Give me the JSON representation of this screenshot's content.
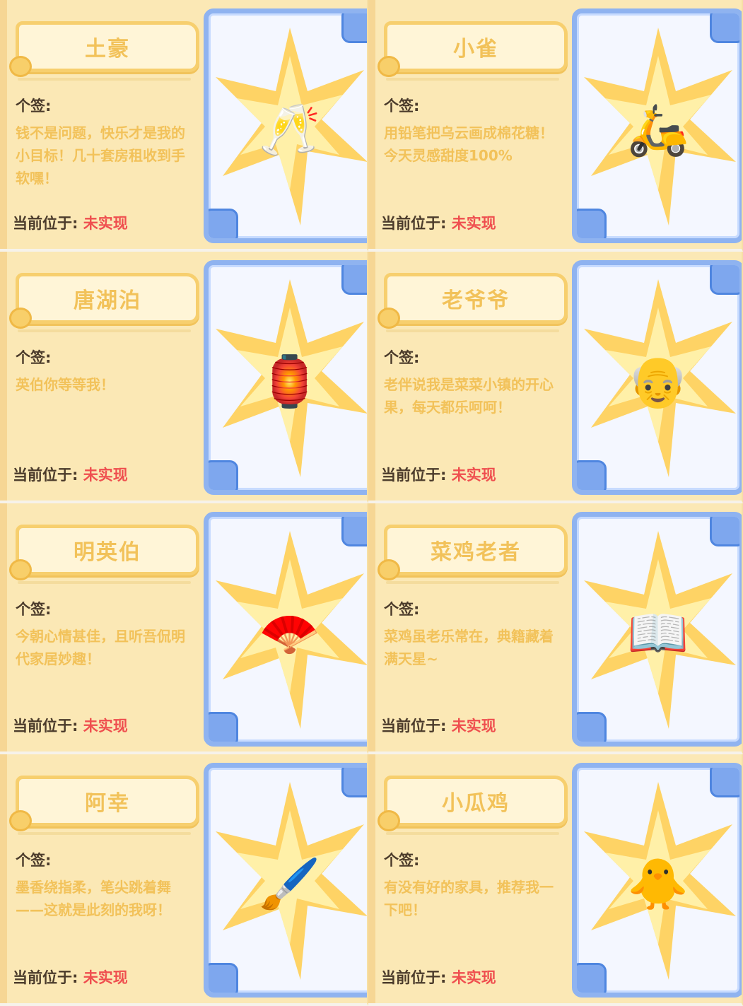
{
  "cards": [
    {
      "name": "土豪",
      "signature_label": "个签:",
      "signature": "钱不是问题，快乐才是我的小目标！几十套房租收到手软嘿！",
      "location_label": "当前位于:",
      "location_value": "未实现",
      "glyph": "🥂"
    },
    {
      "name": "小雀",
      "signature_label": "个签:",
      "signature": "用铅笔把乌云画成棉花糖！今天灵感甜度100%",
      "location_label": "当前位于:",
      "location_value": "未实现",
      "glyph": "🛵"
    },
    {
      "name": "唐湖泊",
      "signature_label": "个签:",
      "signature": "英伯你等等我！",
      "location_label": "当前位于:",
      "location_value": "未实现",
      "glyph": "🏮"
    },
    {
      "name": "老爷爷",
      "signature_label": "个签:",
      "signature": "老伴说我是菜菜小镇的开心果，每天都乐呵呵！",
      "location_label": "当前位于:",
      "location_value": "未实现",
      "glyph": "👴"
    },
    {
      "name": "明英伯",
      "signature_label": "个签:",
      "signature": "今朝心情甚佳，且听吾侃明代家居妙趣！",
      "location_label": "当前位于:",
      "location_value": "未实现",
      "glyph": "🪭"
    },
    {
      "name": "菜鸡老者",
      "signature_label": "个签:",
      "signature": "菜鸡虽老乐常在，典籍藏着满天星~",
      "location_label": "当前位于:",
      "location_value": "未实现",
      "glyph": "📖"
    },
    {
      "name": "阿幸",
      "signature_label": "个签:",
      "signature": "墨香绕指柔，笔尖跳着舞——这就是此刻的我呀！",
      "location_label": "当前位于:",
      "location_value": "未实现",
      "glyph": "🖌️"
    },
    {
      "name": "小瓜鸡",
      "signature_label": "个签:",
      "signature": "有没有好的家具，推荐我一下吧！",
      "location_label": "当前位于:",
      "location_value": "未实现",
      "glyph": "🐥"
    }
  ]
}
